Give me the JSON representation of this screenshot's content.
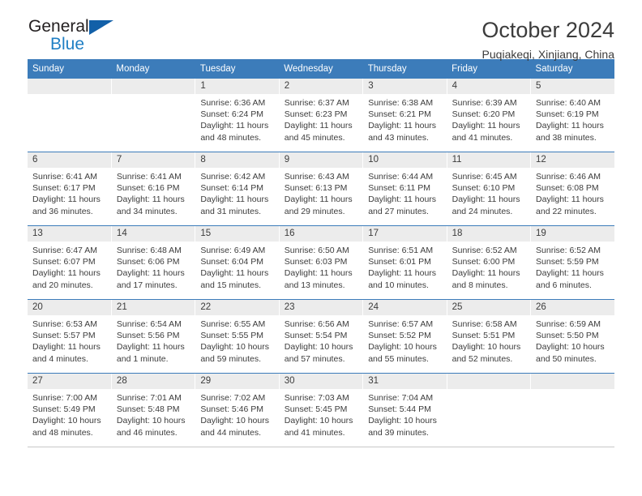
{
  "brand": {
    "name_top": "General",
    "name_bottom": "Blue",
    "triangle_color": "#1260a8",
    "blue_color": "#1f7fc4"
  },
  "header": {
    "title": "October 2024",
    "subtitle": "Puqiakeqi, Xinjiang, China",
    "accent_color": "#3c7cba"
  },
  "labels": {
    "sunrise": "Sunrise:",
    "sunset": "Sunset:",
    "daylight": "Daylight:"
  },
  "weekdays": [
    "Sunday",
    "Monday",
    "Tuesday",
    "Wednesday",
    "Thursday",
    "Friday",
    "Saturday"
  ],
  "weeks": [
    [
      {
        "day": ""
      },
      {
        "day": ""
      },
      {
        "day": "1",
        "sunrise": "Sunrise: 6:36 AM",
        "sunset": "Sunset: 6:24 PM",
        "daylight_line1": "Daylight: 11 hours",
        "daylight_line2": "and 48 minutes."
      },
      {
        "day": "2",
        "sunrise": "Sunrise: 6:37 AM",
        "sunset": "Sunset: 6:23 PM",
        "daylight_line1": "Daylight: 11 hours",
        "daylight_line2": "and 45 minutes."
      },
      {
        "day": "3",
        "sunrise": "Sunrise: 6:38 AM",
        "sunset": "Sunset: 6:21 PM",
        "daylight_line1": "Daylight: 11 hours",
        "daylight_line2": "and 43 minutes."
      },
      {
        "day": "4",
        "sunrise": "Sunrise: 6:39 AM",
        "sunset": "Sunset: 6:20 PM",
        "daylight_line1": "Daylight: 11 hours",
        "daylight_line2": "and 41 minutes."
      },
      {
        "day": "5",
        "sunrise": "Sunrise: 6:40 AM",
        "sunset": "Sunset: 6:19 PM",
        "daylight_line1": "Daylight: 11 hours",
        "daylight_line2": "and 38 minutes."
      }
    ],
    [
      {
        "day": "6",
        "sunrise": "Sunrise: 6:41 AM",
        "sunset": "Sunset: 6:17 PM",
        "daylight_line1": "Daylight: 11 hours",
        "daylight_line2": "and 36 minutes."
      },
      {
        "day": "7",
        "sunrise": "Sunrise: 6:41 AM",
        "sunset": "Sunset: 6:16 PM",
        "daylight_line1": "Daylight: 11 hours",
        "daylight_line2": "and 34 minutes."
      },
      {
        "day": "8",
        "sunrise": "Sunrise: 6:42 AM",
        "sunset": "Sunset: 6:14 PM",
        "daylight_line1": "Daylight: 11 hours",
        "daylight_line2": "and 31 minutes."
      },
      {
        "day": "9",
        "sunrise": "Sunrise: 6:43 AM",
        "sunset": "Sunset: 6:13 PM",
        "daylight_line1": "Daylight: 11 hours",
        "daylight_line2": "and 29 minutes."
      },
      {
        "day": "10",
        "sunrise": "Sunrise: 6:44 AM",
        "sunset": "Sunset: 6:11 PM",
        "daylight_line1": "Daylight: 11 hours",
        "daylight_line2": "and 27 minutes."
      },
      {
        "day": "11",
        "sunrise": "Sunrise: 6:45 AM",
        "sunset": "Sunset: 6:10 PM",
        "daylight_line1": "Daylight: 11 hours",
        "daylight_line2": "and 24 minutes."
      },
      {
        "day": "12",
        "sunrise": "Sunrise: 6:46 AM",
        "sunset": "Sunset: 6:08 PM",
        "daylight_line1": "Daylight: 11 hours",
        "daylight_line2": "and 22 minutes."
      }
    ],
    [
      {
        "day": "13",
        "sunrise": "Sunrise: 6:47 AM",
        "sunset": "Sunset: 6:07 PM",
        "daylight_line1": "Daylight: 11 hours",
        "daylight_line2": "and 20 minutes."
      },
      {
        "day": "14",
        "sunrise": "Sunrise: 6:48 AM",
        "sunset": "Sunset: 6:06 PM",
        "daylight_line1": "Daylight: 11 hours",
        "daylight_line2": "and 17 minutes."
      },
      {
        "day": "15",
        "sunrise": "Sunrise: 6:49 AM",
        "sunset": "Sunset: 6:04 PM",
        "daylight_line1": "Daylight: 11 hours",
        "daylight_line2": "and 15 minutes."
      },
      {
        "day": "16",
        "sunrise": "Sunrise: 6:50 AM",
        "sunset": "Sunset: 6:03 PM",
        "daylight_line1": "Daylight: 11 hours",
        "daylight_line2": "and 13 minutes."
      },
      {
        "day": "17",
        "sunrise": "Sunrise: 6:51 AM",
        "sunset": "Sunset: 6:01 PM",
        "daylight_line1": "Daylight: 11 hours",
        "daylight_line2": "and 10 minutes."
      },
      {
        "day": "18",
        "sunrise": "Sunrise: 6:52 AM",
        "sunset": "Sunset: 6:00 PM",
        "daylight_line1": "Daylight: 11 hours",
        "daylight_line2": "and 8 minutes."
      },
      {
        "day": "19",
        "sunrise": "Sunrise: 6:52 AM",
        "sunset": "Sunset: 5:59 PM",
        "daylight_line1": "Daylight: 11 hours",
        "daylight_line2": "and 6 minutes."
      }
    ],
    [
      {
        "day": "20",
        "sunrise": "Sunrise: 6:53 AM",
        "sunset": "Sunset: 5:57 PM",
        "daylight_line1": "Daylight: 11 hours",
        "daylight_line2": "and 4 minutes."
      },
      {
        "day": "21",
        "sunrise": "Sunrise: 6:54 AM",
        "sunset": "Sunset: 5:56 PM",
        "daylight_line1": "Daylight: 11 hours",
        "daylight_line2": "and 1 minute."
      },
      {
        "day": "22",
        "sunrise": "Sunrise: 6:55 AM",
        "sunset": "Sunset: 5:55 PM",
        "daylight_line1": "Daylight: 10 hours",
        "daylight_line2": "and 59 minutes."
      },
      {
        "day": "23",
        "sunrise": "Sunrise: 6:56 AM",
        "sunset": "Sunset: 5:54 PM",
        "daylight_line1": "Daylight: 10 hours",
        "daylight_line2": "and 57 minutes."
      },
      {
        "day": "24",
        "sunrise": "Sunrise: 6:57 AM",
        "sunset": "Sunset: 5:52 PM",
        "daylight_line1": "Daylight: 10 hours",
        "daylight_line2": "and 55 minutes."
      },
      {
        "day": "25",
        "sunrise": "Sunrise: 6:58 AM",
        "sunset": "Sunset: 5:51 PM",
        "daylight_line1": "Daylight: 10 hours",
        "daylight_line2": "and 52 minutes."
      },
      {
        "day": "26",
        "sunrise": "Sunrise: 6:59 AM",
        "sunset": "Sunset: 5:50 PM",
        "daylight_line1": "Daylight: 10 hours",
        "daylight_line2": "and 50 minutes."
      }
    ],
    [
      {
        "day": "27",
        "sunrise": "Sunrise: 7:00 AM",
        "sunset": "Sunset: 5:49 PM",
        "daylight_line1": "Daylight: 10 hours",
        "daylight_line2": "and 48 minutes."
      },
      {
        "day": "28",
        "sunrise": "Sunrise: 7:01 AM",
        "sunset": "Sunset: 5:48 PM",
        "daylight_line1": "Daylight: 10 hours",
        "daylight_line2": "and 46 minutes."
      },
      {
        "day": "29",
        "sunrise": "Sunrise: 7:02 AM",
        "sunset": "Sunset: 5:46 PM",
        "daylight_line1": "Daylight: 10 hours",
        "daylight_line2": "and 44 minutes."
      },
      {
        "day": "30",
        "sunrise": "Sunrise: 7:03 AM",
        "sunset": "Sunset: 5:45 PM",
        "daylight_line1": "Daylight: 10 hours",
        "daylight_line2": "and 41 minutes."
      },
      {
        "day": "31",
        "sunrise": "Sunrise: 7:04 AM",
        "sunset": "Sunset: 5:44 PM",
        "daylight_line1": "Daylight: 10 hours",
        "daylight_line2": "and 39 minutes."
      },
      {
        "day": ""
      },
      {
        "day": ""
      }
    ]
  ]
}
